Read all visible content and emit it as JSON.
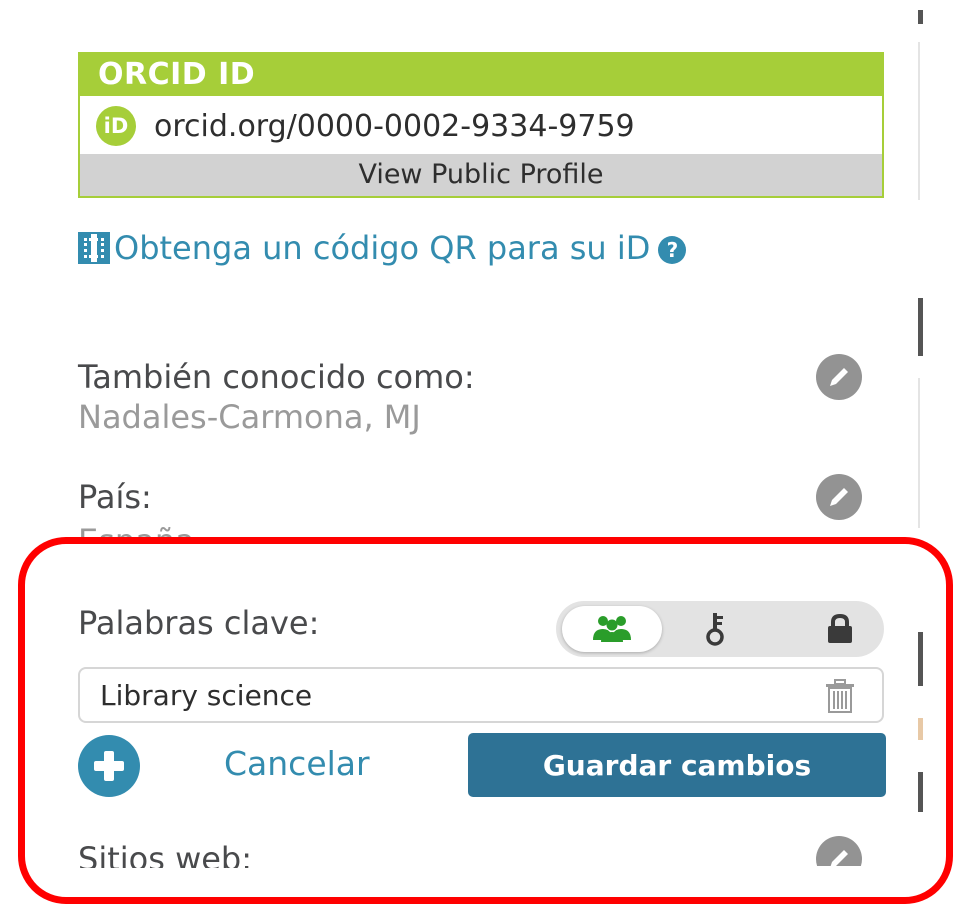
{
  "orcid": {
    "header": "ORCID ID",
    "logo": "iD",
    "url": "orcid.org/0000-0002-9334-9759",
    "public_profile": "View Public Profile"
  },
  "qr": {
    "link_text": "Obtenga un código QR para su iD",
    "help_glyph": "?"
  },
  "aka": {
    "label": "También conocido como:",
    "value": "Nadales-Carmona, MJ"
  },
  "country": {
    "label": "País:",
    "value": "España"
  },
  "keywords": {
    "label": "Palabras clave:",
    "privacy": {
      "options": [
        "everyone-icon",
        "key-icon",
        "lock-icon"
      ],
      "selected": "everyone-icon",
      "selected_color": "#2a9d2a"
    },
    "input_value": "Library science",
    "cancel_label": "Cancelar",
    "save_label": "Guardar cambios"
  },
  "websites": {
    "label": "Sitios web:"
  },
  "colors": {
    "orcid_green": "#a6ce39",
    "link_blue": "#338caf",
    "save_button": "#2e7295",
    "highlight": "#ff0000"
  }
}
